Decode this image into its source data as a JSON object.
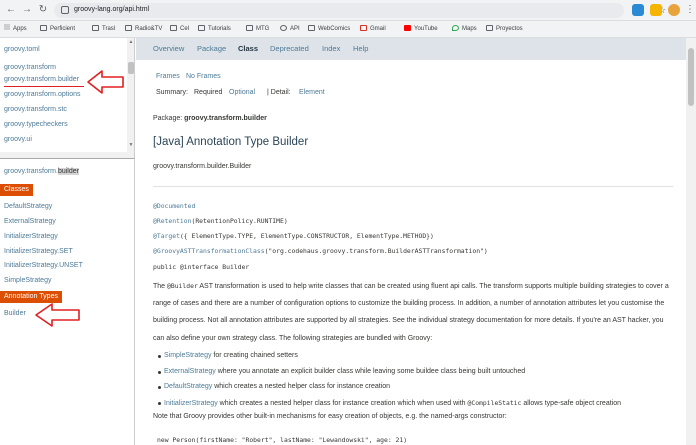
{
  "browser": {
    "url": "groovy-lang.org/api.html",
    "bookmarks": [
      "Apps",
      "Perficient",
      "Trasl",
      "Radio&TV",
      "Cel",
      "Tutorials",
      "MTG",
      "API",
      "WebComics",
      "Gmail",
      "YouTube",
      "Maps",
      "Proyectos"
    ]
  },
  "packages": {
    "items": [
      "groovy.toml",
      "groovy.transform",
      "groovy.transform.builder",
      "groovy.transform.options",
      "groovy.transform.stc",
      "groovy.typecheckers",
      "groovy.ui"
    ]
  },
  "package_frame": {
    "title_prefix": "groovy.transform.",
    "title_highlight": "builder",
    "classes_heading": "Classes",
    "classes": [
      "DefaultStrategy",
      "ExternalStrategy",
      "InitializerStrategy",
      "InitializerStrategy.SET",
      "InitializerStrategy.UNSET",
      "SimpleStrategy"
    ],
    "annotation_heading": "Annotation Types",
    "annotations": [
      "Builder"
    ]
  },
  "navbar": {
    "items": [
      "Overview",
      "Package",
      "Class",
      "Deprecated",
      "Index",
      "Help"
    ],
    "active": "Class"
  },
  "content": {
    "frames": "Frames",
    "no_frames": "No Frames",
    "summary_label": "Summary:",
    "summary_required": "Required",
    "summary_optional": "Optional",
    "detail_label": "| Detail:",
    "detail_element": "Element",
    "package_label": "Package:",
    "package_name": "groovy.transform.builder",
    "title": "[Java] Annotation Type Builder",
    "fqcn": "groovy.transform.builder.Builder",
    "code": {
      "a1": "@Documented",
      "a2_anno": "@Retention",
      "a2_rest": "(RetentionPolicy.RUNTIME)",
      "a3_anno": "@Target",
      "a3_rest": "({ ElementType.TYPE, ElementType.CONSTRUCTOR, ElementType.METHOD})",
      "a4_anno": "@GroovyASTTransformationClass",
      "a4_rest": "(\"org.codehaus.groovy.transform.BuilderASTTransformation\")",
      "a5": "public @interface Builder"
    },
    "para1_pre": "The ",
    "para1_mono": "@Builder",
    "para1_post": " AST transformation is used to help write classes that can be created using fluent api calls. The transform supports multiple building strategies to cover a range of cases and there are a number of configuration options to customize the building process. In addition, a number of annotation attributes let you customise the building process. Not all annotation attributes are supported by all strategies. See the individual strategy documentation for more details. If you're an AST hacker, you can also define your own strategy class. The following strategies are bundled with Groovy:",
    "bullets": [
      {
        "link": "SimpleStrategy",
        "text": " for creating chained setters"
      },
      {
        "link": "ExternalStrategy",
        "text": " where you annotate an explicit builder class while leaving some buildee class being built untouched"
      },
      {
        "link": "DefaultStrategy",
        "text": " which creates a nested helper class for instance creation"
      },
      {
        "link": "InitializerStrategy",
        "text": " which creates a nested helper class for instance creation which when used with ",
        "mono": "@CompileStatic",
        "tail": " allows type-safe object creation"
      }
    ],
    "note": "Note that Groovy provides other built-in mechanisms for easy creation of objects, e.g. the named-args constructor:",
    "code_bottom": "new Person(firstName: \"Robert\", lastName: \"Lewandowski\", age: 21)"
  },
  "colors": {
    "accent_orange": "#dd4e05",
    "link_blue": "#4d7a97",
    "nav_bg": "#dee3e9",
    "annotation_red": "#e02020"
  }
}
